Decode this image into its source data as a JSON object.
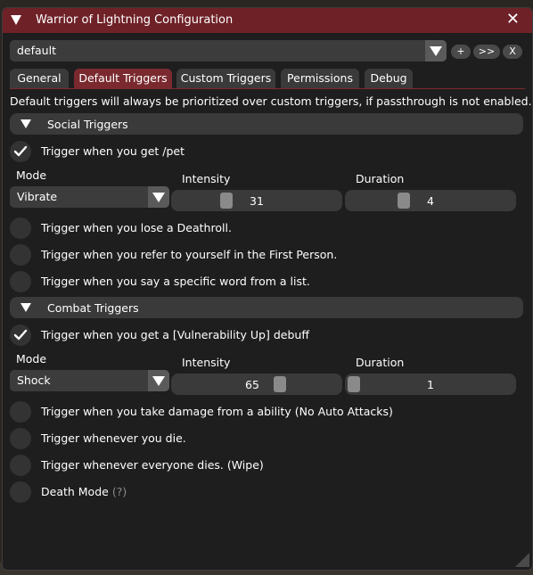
{
  "window": {
    "title": "Warrior of Lightning Configuration",
    "close_label": "✕"
  },
  "profile": {
    "value": "default",
    "buttons": {
      "add": "+",
      "next": ">>",
      "remove": "X"
    }
  },
  "tabs": [
    {
      "label": "General"
    },
    {
      "label": "Default Triggers"
    },
    {
      "label": "Custom Triggers"
    },
    {
      "label": "Permissions"
    },
    {
      "label": "Debug"
    }
  ],
  "active_tab": "Default Triggers",
  "description": "Default triggers will always be prioritized over custom triggers, if passthrough is not enabled.",
  "social": {
    "header": "Social Triggers",
    "pet": {
      "label": "Trigger when you get /pet",
      "checked": true
    },
    "mode_label": "Mode",
    "mode_value": "Vibrate",
    "intensity_label": "Intensity",
    "intensity_value": "31",
    "duration_label": "Duration",
    "duration_value": "4",
    "items": [
      {
        "label": "Trigger when you lose a Deathroll.",
        "checked": false
      },
      {
        "label": "Trigger when you refer to yourself in the First Person.",
        "checked": false
      },
      {
        "label": "Trigger when you say a specific word from a list.",
        "checked": false
      }
    ]
  },
  "combat": {
    "header": "Combat Triggers",
    "vuln": {
      "label": "Trigger when you get a [Vulnerability Up] debuff",
      "checked": true
    },
    "mode_label": "Mode",
    "mode_value": "Shock",
    "intensity_label": "Intensity",
    "intensity_value": "65",
    "duration_label": "Duration",
    "duration_value": "1",
    "items": [
      {
        "label": "Trigger when you take damage from a ability (No Auto Attacks)",
        "checked": false
      },
      {
        "label": "Trigger whenever you die.",
        "checked": false
      },
      {
        "label": "Trigger whenever everyone dies. (Wipe)",
        "checked": false
      }
    ],
    "death_mode": {
      "label": "Death Mode",
      "help": "(?)",
      "checked": false
    }
  },
  "colors": {
    "title_bar": "#6e2127",
    "active_tab": "#7a2a2f",
    "window_bg": "#1e1e1e",
    "frame_bg": "#3a3a3a"
  }
}
